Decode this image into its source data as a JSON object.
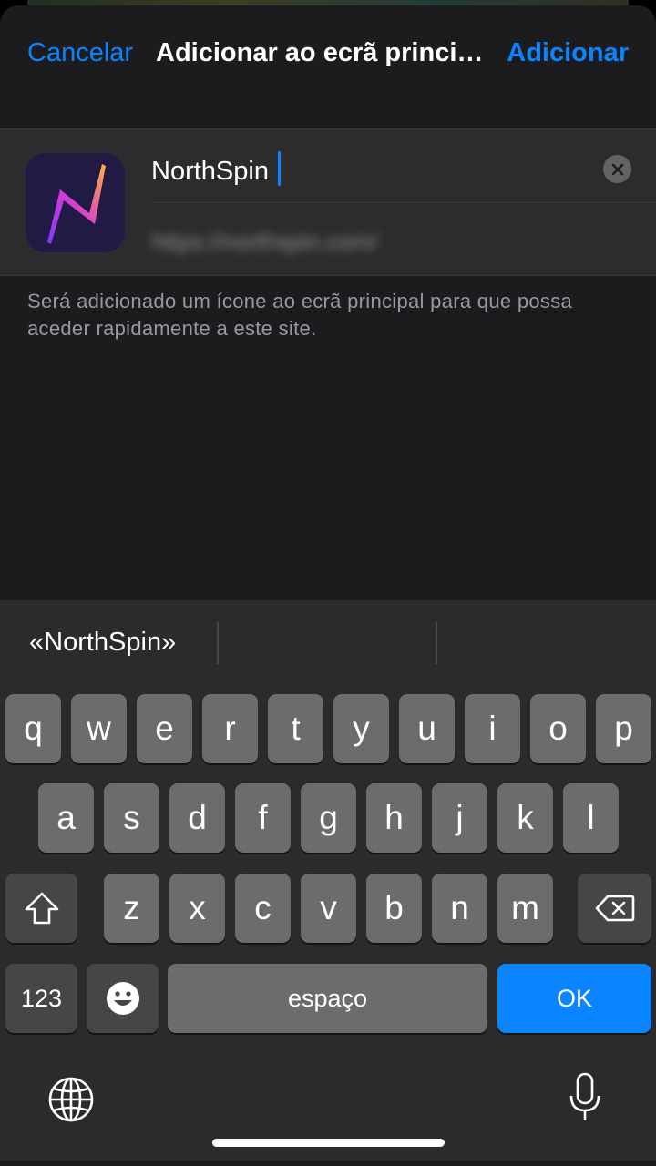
{
  "nav": {
    "cancel_label": "Cancelar",
    "title": "Adicionar ao ecrã principal",
    "add_label": "Adicionar"
  },
  "bookmark": {
    "name_value": "NorthSpin",
    "url": "https://northspin.com/"
  },
  "description": "Será adicionado um ícone ao ecrã principal para que possa aceder rapidamente a este site.",
  "keyboard": {
    "suggestion": "«NorthSpin»",
    "row1": [
      "q",
      "w",
      "e",
      "r",
      "t",
      "y",
      "u",
      "i",
      "o",
      "p"
    ],
    "row2": [
      "a",
      "s",
      "d",
      "f",
      "g",
      "h",
      "j",
      "k",
      "l"
    ],
    "row3": [
      "z",
      "x",
      "c",
      "v",
      "b",
      "n",
      "m"
    ],
    "numbers_label": "123",
    "space_label": "espaço",
    "ok_label": "OK"
  },
  "colors": {
    "accent": "#0a84ff",
    "sheet_bg": "#1c1c1e",
    "key_bg": "#6c6c6f"
  }
}
